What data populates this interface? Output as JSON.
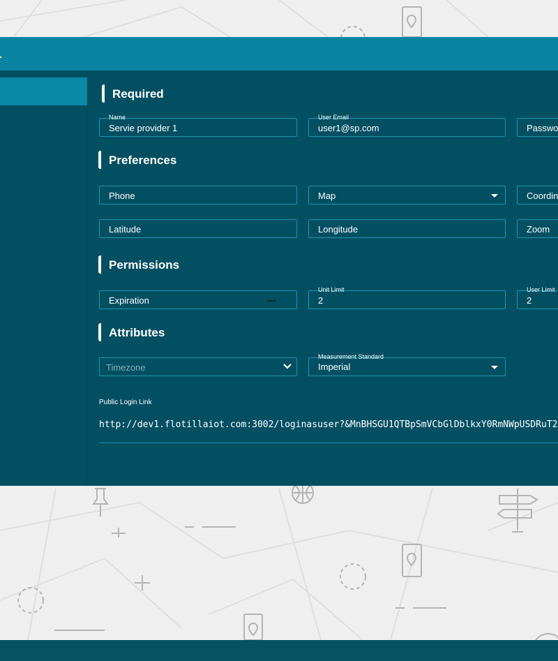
{
  "sections": {
    "required": "Required",
    "preferences": "Preferences",
    "permissions": "Permissions",
    "attributes": "Attributes"
  },
  "fields": {
    "name": {
      "label": "Name",
      "value": "Servie provider 1"
    },
    "user_email": {
      "label": "User Email",
      "value": "user1@sp.com"
    },
    "password": {
      "value": "Passwor"
    },
    "phone": {
      "value": "Phone"
    },
    "map": {
      "value": "Map"
    },
    "coordinates": {
      "value": "Coordina"
    },
    "latitude": {
      "value": "Latitude"
    },
    "longitude": {
      "value": "Longitude"
    },
    "zoom": {
      "value": "Zoom"
    },
    "expiration": {
      "value": "Expiration"
    },
    "unit_limit": {
      "label": "Unit Limit",
      "value": "2"
    },
    "user_limit": {
      "label": "User Limit",
      "value": "2"
    },
    "timezone": {
      "placeholder": "Timezone"
    },
    "measurement_standard": {
      "label": "Measurement Standard",
      "value": "Imperial"
    }
  },
  "public_login": {
    "label": "Public Login Link",
    "url": "http://dev1.flotillaiot.com:3002/loginasuser?&MnBHSGU1QTBpSmVCbGlDblkxY0RmNWpUSDRuT2"
  },
  "colors": {
    "header": "#0a84a0",
    "panel": "#034f62",
    "sidebar_active": "#0b88a4",
    "field_border": "#1796b0",
    "page_background": "#efefef"
  },
  "icons": [
    "dropdown-caret-icon",
    "chevron-down-icon",
    "map-pin-icon",
    "globe-icon",
    "signpost-icon",
    "pushpin-icon"
  ]
}
